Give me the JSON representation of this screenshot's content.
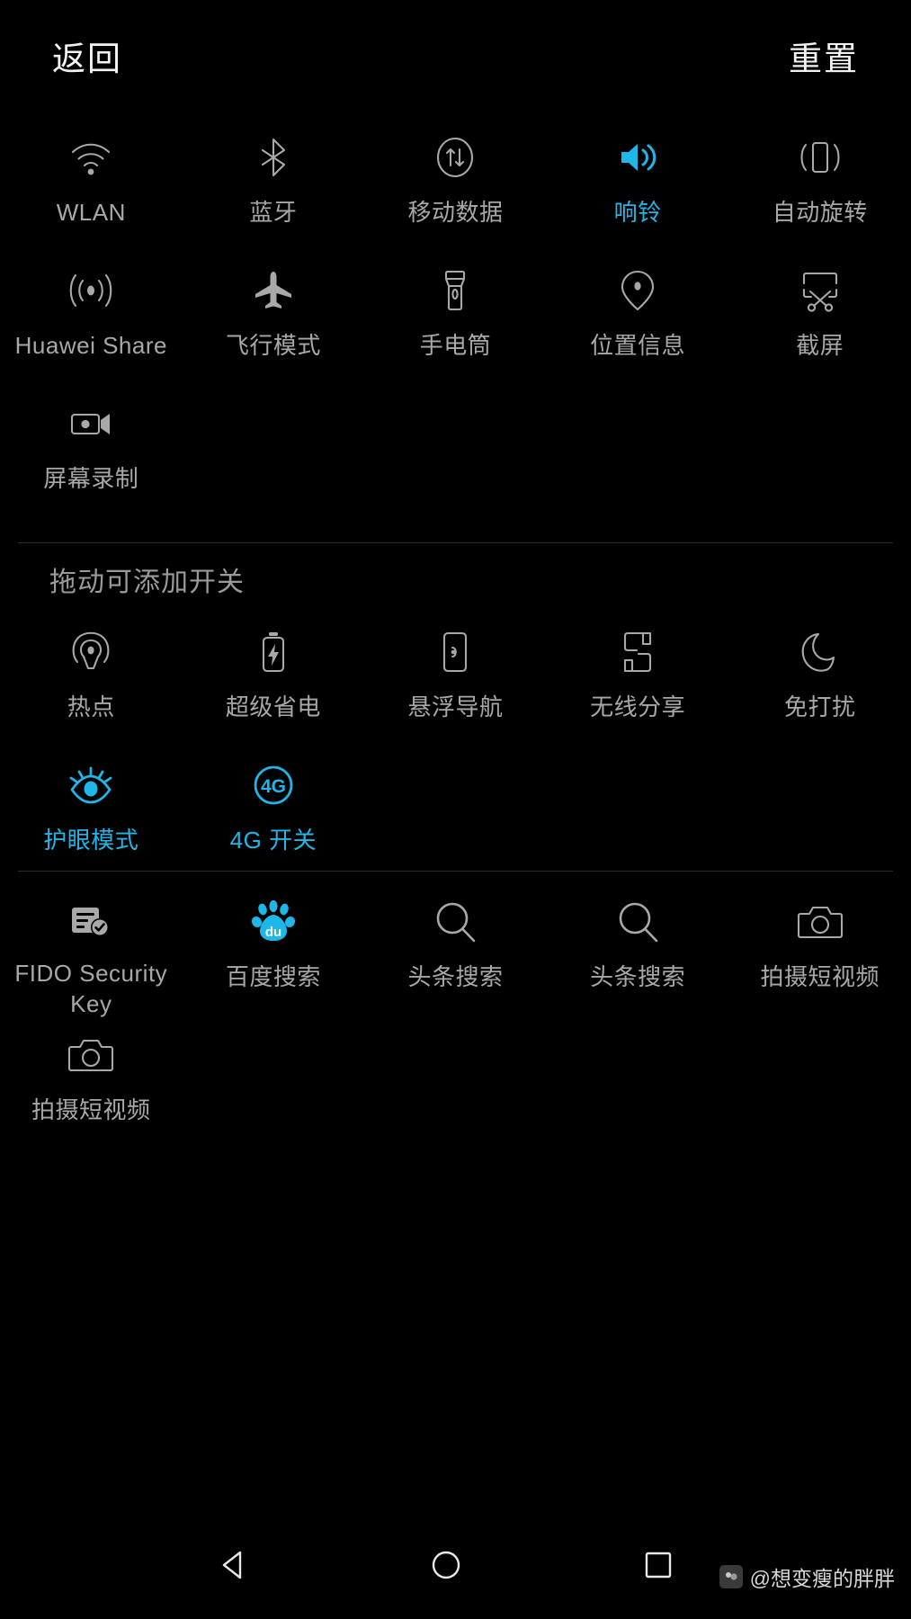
{
  "header": {
    "back_label": "返回",
    "reset_label": "重置"
  },
  "colors": {
    "background": "#000000",
    "icon_inactive": "#a8a8a8",
    "label_inactive": "#a8a8a8",
    "accent_active": "#1fb6e8",
    "divider": "#2b2b2b",
    "header_text": "#f2f2f2"
  },
  "active_section": {
    "tiles": [
      {
        "label": "WLAN",
        "icon": "wifi-icon",
        "active": false
      },
      {
        "label": "蓝牙",
        "icon": "bluetooth-icon",
        "active": false
      },
      {
        "label": "移动数据",
        "icon": "mobile-data-icon",
        "active": false
      },
      {
        "label": "响铃",
        "icon": "ringer-icon",
        "active": true
      },
      {
        "label": "自动旋转",
        "icon": "auto-rotate-icon",
        "active": false
      },
      {
        "label": "Huawei Share",
        "icon": "huawei-share-icon",
        "active": false
      },
      {
        "label": "飞行模式",
        "icon": "airplane-icon",
        "active": false
      },
      {
        "label": "手电筒",
        "icon": "flashlight-icon",
        "active": false
      },
      {
        "label": "位置信息",
        "icon": "location-pin-icon",
        "active": false
      },
      {
        "label": "截屏",
        "icon": "screenshot-icon",
        "active": false
      },
      {
        "label": "屏幕录制",
        "icon": "screen-record-icon",
        "active": false
      }
    ]
  },
  "drag_section": {
    "title": "拖动可添加开关",
    "tiles": [
      {
        "label": "热点",
        "icon": "hotspot-icon",
        "active": false
      },
      {
        "label": "超级省电",
        "icon": "super-power-save-icon",
        "active": false
      },
      {
        "label": "悬浮导航",
        "icon": "floating-nav-icon",
        "active": false
      },
      {
        "label": "无线分享",
        "icon": "wireless-share-icon",
        "active": false
      },
      {
        "label": "免打扰",
        "icon": "do-not-disturb-icon",
        "active": false
      },
      {
        "label": "护眼模式",
        "icon": "eye-comfort-icon",
        "active": true
      },
      {
        "label": "4G 开关",
        "icon": "four-g-toggle-icon",
        "active": true
      }
    ]
  },
  "shortcut_section": {
    "tiles": [
      {
        "label": "FIDO Security Key",
        "icon": "fido-security-key-icon",
        "active": false
      },
      {
        "label": "百度搜索",
        "icon": "baidu-search-icon",
        "active": true
      },
      {
        "label": "头条搜索",
        "icon": "search-icon",
        "active": false
      },
      {
        "label": "头条搜索",
        "icon": "search-icon",
        "active": false
      },
      {
        "label": "拍摄短视频",
        "icon": "camera-icon",
        "active": false
      },
      {
        "label": "拍摄短视频",
        "icon": "camera-icon",
        "active": false
      }
    ]
  },
  "navbar": {
    "back": "back-triangle-icon",
    "home": "home-circle-icon",
    "recents": "recents-square-icon"
  },
  "watermark": {
    "text": "@想变瘦的胖胖"
  }
}
